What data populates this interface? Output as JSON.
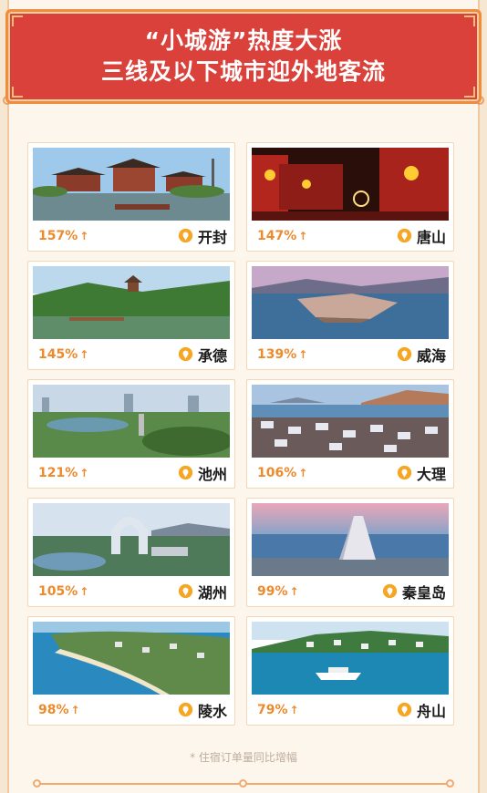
{
  "header": {
    "line1": "“小城游”热度大涨",
    "line2": "三线及以下城市迎外地客流"
  },
  "cards": [
    {
      "pct": "157%",
      "arrow": "↑",
      "city": "开封",
      "scene": "pagoda-palace"
    },
    {
      "pct": "147%",
      "arrow": "↑",
      "city": "唐山",
      "scene": "lantern-street"
    },
    {
      "pct": "145%",
      "arrow": "↑",
      "city": "承德",
      "scene": "lake-pavilion"
    },
    {
      "pct": "139%",
      "arrow": "↑",
      "city": "威海",
      "scene": "coastal-city"
    },
    {
      "pct": "121%",
      "arrow": "↑",
      "city": "池州",
      "scene": "city-river"
    },
    {
      "pct": "106%",
      "arrow": "↑",
      "city": "大理",
      "scene": "lakeside-village"
    },
    {
      "pct": "105%",
      "arrow": "↑",
      "city": "湖州",
      "scene": "arch-hotel"
    },
    {
      "pct": "99%",
      "arrow": "↑",
      "city": "秦皇岛",
      "scene": "seaside-chapel"
    },
    {
      "pct": "98%",
      "arrow": "↑",
      "city": "陵水",
      "scene": "tropical-bay"
    },
    {
      "pct": "79%",
      "arrow": "↑",
      "city": "舟山",
      "scene": "island-ferry"
    }
  ],
  "footnote": "* 住宿订单量同比增幅",
  "colors": {
    "header_red": "#d9413a",
    "accent_orange": "#ec8a2c",
    "pin_yellow": "#f5a623"
  }
}
